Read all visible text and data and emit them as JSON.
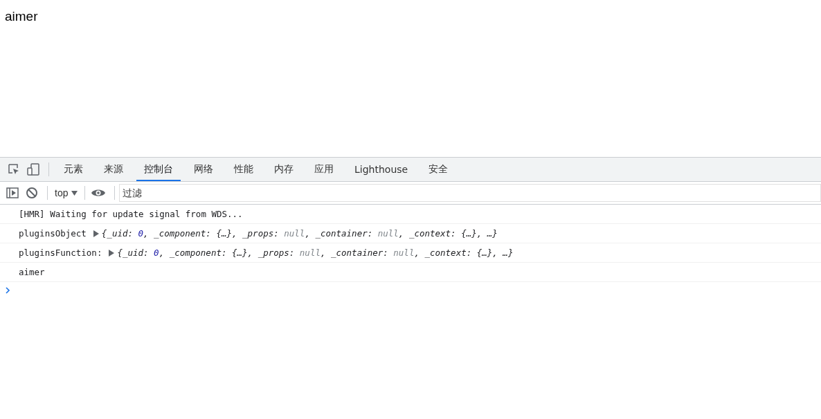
{
  "page": {
    "text": "aimer"
  },
  "devtools": {
    "tabs": [
      {
        "label": "元素",
        "selected": false
      },
      {
        "label": "来源",
        "selected": false
      },
      {
        "label": "控制台",
        "selected": true
      },
      {
        "label": "网络",
        "selected": false
      },
      {
        "label": "性能",
        "selected": false
      },
      {
        "label": "内存",
        "selected": false
      },
      {
        "label": "应用",
        "selected": false
      },
      {
        "label": "Lighthouse",
        "selected": false
      },
      {
        "label": "安全",
        "selected": false
      }
    ],
    "toolbar": {
      "context": "top",
      "filter": {
        "placeholder": "过滤"
      }
    },
    "messages": [
      {
        "kind": "text",
        "text": "[HMR] Waiting for update signal from WDS..."
      },
      {
        "kind": "object",
        "label": "pluginsObject",
        "preview": [
          {
            "kind": "plain",
            "text": "{_uid: "
          },
          {
            "kind": "number",
            "text": "0"
          },
          {
            "kind": "plain",
            "text": ", _component: {…}, _props: "
          },
          {
            "kind": "null",
            "text": "null"
          },
          {
            "kind": "plain",
            "text": ", _container: "
          },
          {
            "kind": "null",
            "text": "null"
          },
          {
            "kind": "plain",
            "text": ", _context: {…}, …}"
          }
        ]
      },
      {
        "kind": "object",
        "label": "pluginsFunction:",
        "preview": [
          {
            "kind": "plain",
            "text": "{_uid: "
          },
          {
            "kind": "number",
            "text": "0"
          },
          {
            "kind": "plain",
            "text": ", _component: {…}, _props: "
          },
          {
            "kind": "null",
            "text": "null"
          },
          {
            "kind": "plain",
            "text": ", _container: "
          },
          {
            "kind": "null",
            "text": "null"
          },
          {
            "kind": "plain",
            "text": ", _context: {…}, …}"
          }
        ]
      },
      {
        "kind": "text",
        "text": "aimer"
      }
    ]
  }
}
